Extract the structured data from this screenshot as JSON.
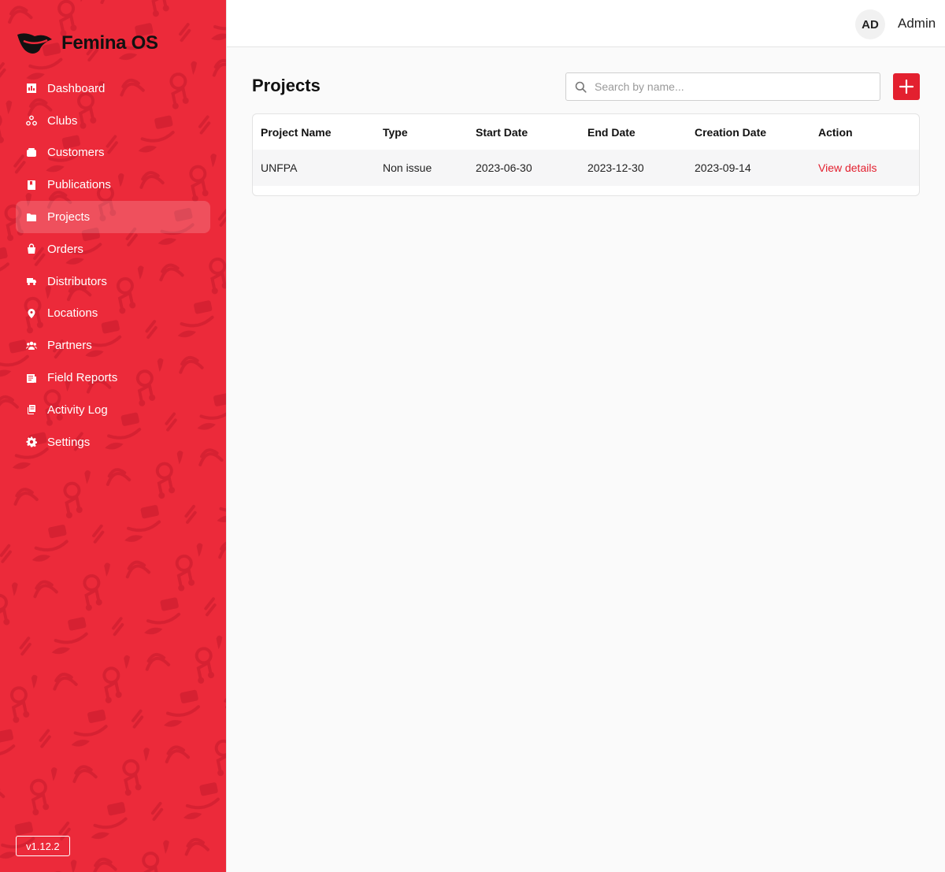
{
  "app": {
    "name": "Femina OS",
    "version": "v1.12.2"
  },
  "sidebar": {
    "items": [
      {
        "label": "Dashboard",
        "icon": "dashboard-icon"
      },
      {
        "label": "Clubs",
        "icon": "clubs-icon"
      },
      {
        "label": "Customers",
        "icon": "customers-icon"
      },
      {
        "label": "Publications",
        "icon": "publications-icon"
      },
      {
        "label": "Projects",
        "icon": "folder-icon",
        "active": true
      },
      {
        "label": "Orders",
        "icon": "shopping-bag-icon"
      },
      {
        "label": "Distributors",
        "icon": "truck-icon"
      },
      {
        "label": "Locations",
        "icon": "map-pin-icon"
      },
      {
        "label": "Partners",
        "icon": "users-icon"
      },
      {
        "label": "Field Reports",
        "icon": "report-icon"
      },
      {
        "label": "Activity Log",
        "icon": "activity-log-icon"
      },
      {
        "label": "Settings",
        "icon": "gear-icon"
      }
    ]
  },
  "header": {
    "avatar_initials": "AD",
    "user_name": "Admin"
  },
  "main": {
    "title": "Projects",
    "search": {
      "placeholder": "Search by name...",
      "value": ""
    },
    "add_button": "plus-icon",
    "table": {
      "columns": [
        "Project Name",
        "Type",
        "Start Date",
        "End Date",
        "Creation Date",
        "Action"
      ],
      "rows": [
        {
          "name": "UNFPA",
          "type": "Non issue",
          "start": "2023-06-30",
          "end": "2023-12-30",
          "created": "2023-09-14",
          "action": "View details"
        }
      ]
    }
  },
  "colors": {
    "brand": "#ec2a3a",
    "accent": "#e3202f",
    "background": "#fafafa"
  }
}
